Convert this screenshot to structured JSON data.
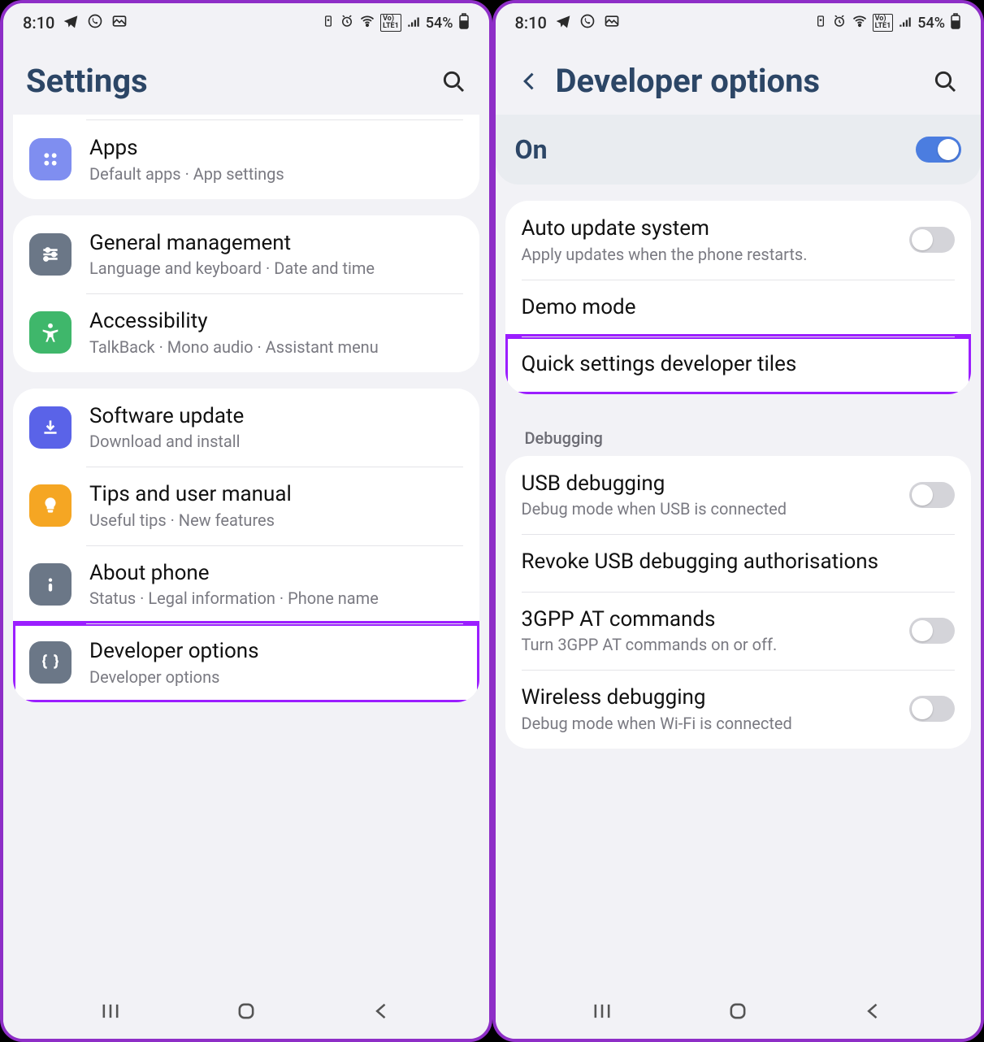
{
  "statusbar": {
    "time": "8:10",
    "battery": "54%"
  },
  "left": {
    "title": "Settings",
    "items": [
      {
        "icon": "apps",
        "title": "Apps",
        "sub": "Default apps  ·  App settings",
        "color": "#7f8ef0"
      },
      {
        "icon": "general",
        "title": "General management",
        "sub": "Language and keyboard  ·  Date and time",
        "color": "#6b7787"
      },
      {
        "icon": "accessibility",
        "title": "Accessibility",
        "sub": "TalkBack  ·  Mono audio  ·  Assistant menu",
        "color": "#3fb76b"
      },
      {
        "icon": "update",
        "title": "Software update",
        "sub": "Download and install",
        "color": "#5a63e8"
      },
      {
        "icon": "tips",
        "title": "Tips and user manual",
        "sub": "Useful tips  ·  New features",
        "color": "#f5a623"
      },
      {
        "icon": "about",
        "title": "About phone",
        "sub": "Status  ·  Legal information  ·  Phone name",
        "color": "#6b7787"
      },
      {
        "icon": "dev",
        "title": "Developer options",
        "sub": "Developer options",
        "color": "#6b7787",
        "highlight": true
      }
    ]
  },
  "right": {
    "title": "Developer options",
    "master": {
      "label": "On",
      "on": true
    },
    "section1": [
      {
        "title": "Auto update system",
        "sub": "Apply updates when the phone restarts.",
        "toggle": false
      },
      {
        "title": "Demo mode"
      },
      {
        "title": "Quick settings developer tiles",
        "highlight": true
      }
    ],
    "section2_header": "Debugging",
    "section2": [
      {
        "title": "USB debugging",
        "sub": "Debug mode when USB is connected",
        "toggle": false
      },
      {
        "title": "Revoke USB debugging authorisations"
      },
      {
        "title": "3GPP AT commands",
        "sub": "Turn 3GPP AT commands on or off.",
        "toggle": false
      },
      {
        "title": "Wireless debugging",
        "sub": "Debug mode when Wi-Fi is connected",
        "toggle": false
      }
    ]
  }
}
